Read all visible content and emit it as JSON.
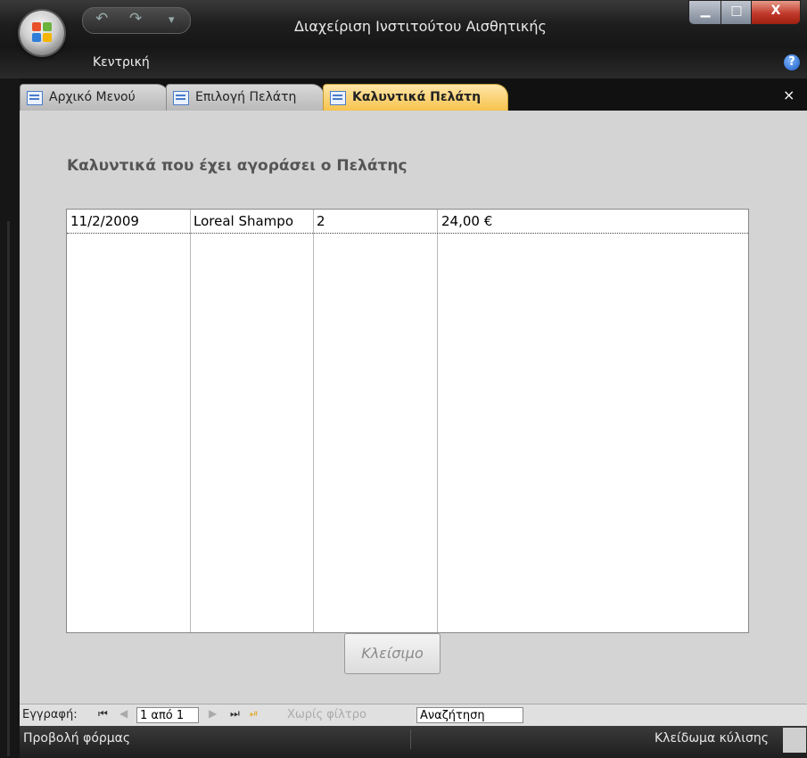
{
  "window": {
    "title": "Διαχείριση Ινστιτούτου Αισθητικής",
    "ribbon_tab": "Κεντρική",
    "help_label": "?",
    "controls": {
      "minimize": "▁",
      "maximize": "□",
      "close": "X"
    }
  },
  "quick_access": {
    "undo": "↶",
    "redo": "↷",
    "customize": "▾"
  },
  "doc_tabs": [
    {
      "label": "Αρχικό Μενού",
      "active": false
    },
    {
      "label": "Επιλογή Πελάτη",
      "active": false
    },
    {
      "label": "Καλυντικά Πελάτη",
      "active": true
    }
  ],
  "tab_close": "×",
  "form": {
    "heading": "Καλυντικά που έχει αγοράσει ο Πελάτης",
    "rows": [
      {
        "date": "11/2/2009",
        "product": "Loreal Shampo",
        "quantity": "2",
        "price": "24,00 €"
      }
    ],
    "close_button": "Κλείσιμο"
  },
  "navigator": {
    "label": "Εγγραφή:",
    "first": "⏮",
    "prev": "◀",
    "record": "1 από 1",
    "next": "▶",
    "last": "⏭",
    "new": "⏯",
    "filter": "Χωρίς φίλτρο",
    "search": "Αναζήτηση"
  },
  "status": {
    "view": "Προβολή φόρμας",
    "scroll_lock": "Κλείδωμα κύλισης"
  },
  "colors": {
    "active_tab": "#f6c24a",
    "form_bg": "#d4d4d4",
    "title_bar": "#1e1e1e",
    "close_button": "#c0392b"
  }
}
